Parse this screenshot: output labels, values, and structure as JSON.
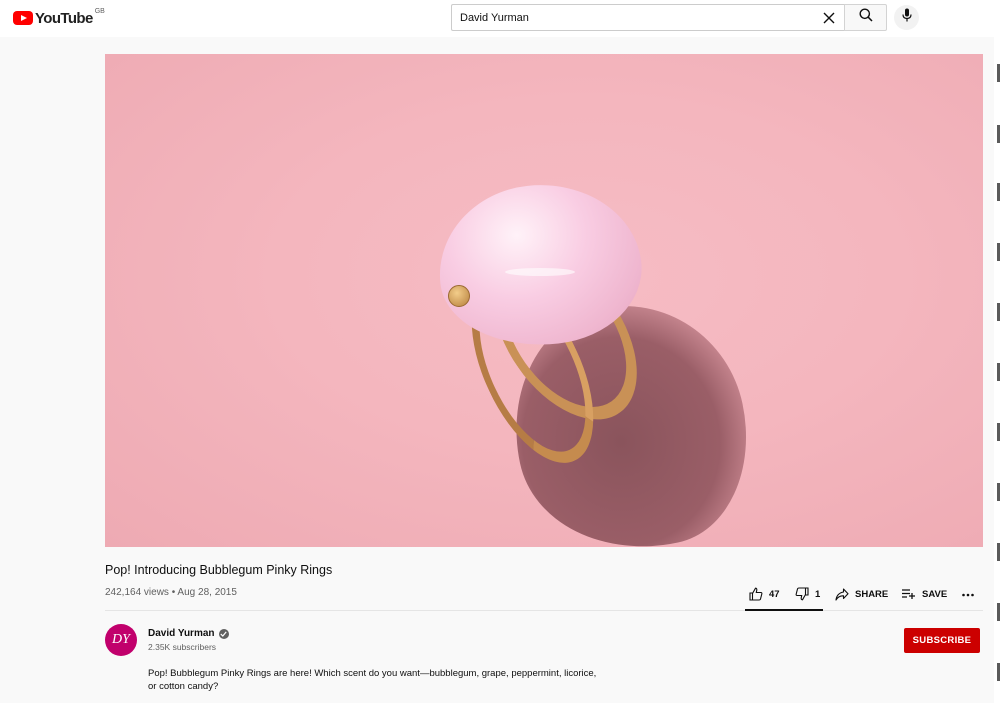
{
  "header": {
    "logo_text": "YouTube",
    "region": "GB",
    "search": {
      "value": "David Yurman",
      "placeholder": "Search"
    },
    "icons": {
      "clear": "close-icon",
      "search": "search-icon",
      "mic": "microphone-icon"
    }
  },
  "video": {
    "title": "Pop! Introducing Bubblegum Pinky Rings",
    "meta": "242,164 views • Aug 28, 2015",
    "actions": {
      "likes": "47",
      "dislikes": "1",
      "share": "SHARE",
      "save": "SAVE"
    }
  },
  "channel": {
    "avatar_text": "DY",
    "name": "David Yurman",
    "subscribers": "2.35K subscribers",
    "subscribe_label": "SUBSCRIBE"
  },
  "description": "Pop! Bubblegum Pinky Rings are here! Which scent do you want—bubblegum, grape, peppermint, licorice, or cotton candy?",
  "colors": {
    "brand_red": "#ff0000",
    "subscribe_red": "#cc0000",
    "avatar_magenta": "#c1006c"
  }
}
